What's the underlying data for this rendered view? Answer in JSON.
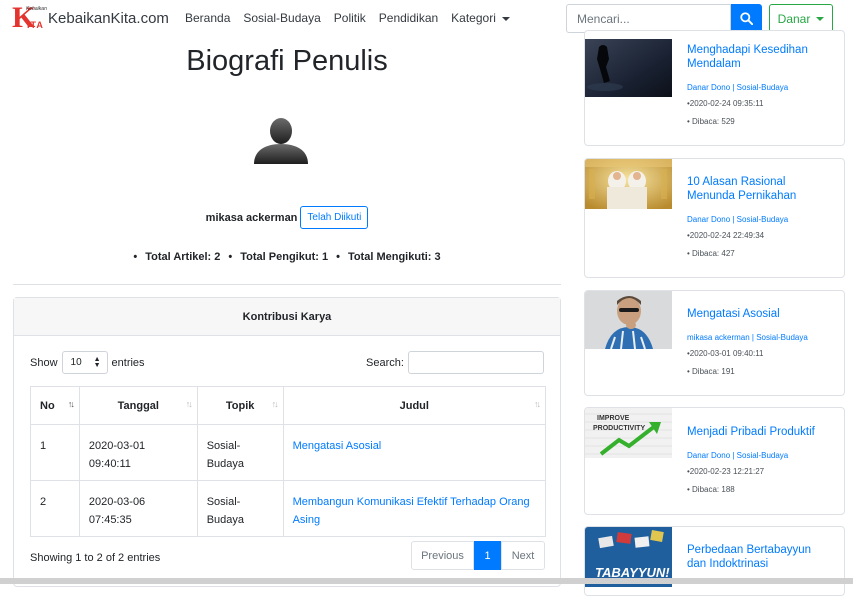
{
  "navbar": {
    "brand_tagline": "Kebaikan",
    "brand_logo_letters": "ITA",
    "brand_name": "KebaikanKita.com",
    "nav_items": [
      "Beranda",
      "Sosial-Budaya",
      "Politik",
      "Pendidikan",
      "Kategori"
    ],
    "search_placeholder": "Mencari...",
    "user_button": "Danar"
  },
  "profile": {
    "title": "Biografi Penulis",
    "author_name": "mikasa ackerman",
    "follow_button": "Telah Diikuti",
    "stats": [
      "Total Artikel: 2",
      "Total Pengikut: 1",
      "Total Mengikuti: 3"
    ]
  },
  "contributions": {
    "header": "Kontribusi Karya",
    "show_label": "Show",
    "entries_value": "10",
    "entries_label": "entries",
    "search_label": "Search:",
    "columns": [
      "No",
      "Tanggal",
      "Topik",
      "Judul"
    ],
    "rows": [
      {
        "no": "1",
        "date": "2020-03-01 09:40:11",
        "topic": "Sosial-Budaya",
        "title": "Mengatasi Asosial"
      },
      {
        "no": "2",
        "date": "2020-03-06 07:45:35",
        "topic": "Sosial-Budaya",
        "title": "Membangun Komunikasi Efektif Terhadap Orang Asing"
      }
    ],
    "info": "Showing 1 to 2 of 2 entries",
    "pager": {
      "prev": "Previous",
      "current": "1",
      "next": "Next"
    }
  },
  "sidebar": {
    "articles": [
      {
        "title": "Menghadapi Kesedihan Mendalam",
        "author": "Danar Dono",
        "category": "Sosial-Budaya",
        "date": "•2020-02-24 09:35:11",
        "reads": "• Dibaca: 529"
      },
      {
        "title": "10 Alasan Rasional Menunda Pernikahan",
        "author": "Danar Dono",
        "category": "Sosial-Budaya",
        "date": "•2020-02-24 22:49:34",
        "reads": "• Dibaca: 427"
      },
      {
        "title": "Mengatasi Asosial",
        "author": "mikasa ackerman",
        "category": "Sosial-Budaya",
        "date": "•2020-03-01 09:40:11",
        "reads": "• Dibaca: 191"
      },
      {
        "title": "Menjadi Pribadi Produktif",
        "author": "Danar Dono",
        "category": "Sosial-Budaya",
        "date": "•2020-02-23 12:21:27",
        "reads": "• Dibaca: 188"
      },
      {
        "title": "Perbedaan Bertabayyun dan Indoktrinasi",
        "author": "",
        "category": "",
        "date": "",
        "reads": ""
      }
    ],
    "thumb_text_improve": "IMPROVE",
    "thumb_text_productivity": "PRODUCTIVITY",
    "thumb_text_tabayyun": "TABAYYUN!"
  },
  "colors": {
    "primary": "#007bff",
    "success": "#28a745",
    "brand_red": "#e3342f"
  }
}
